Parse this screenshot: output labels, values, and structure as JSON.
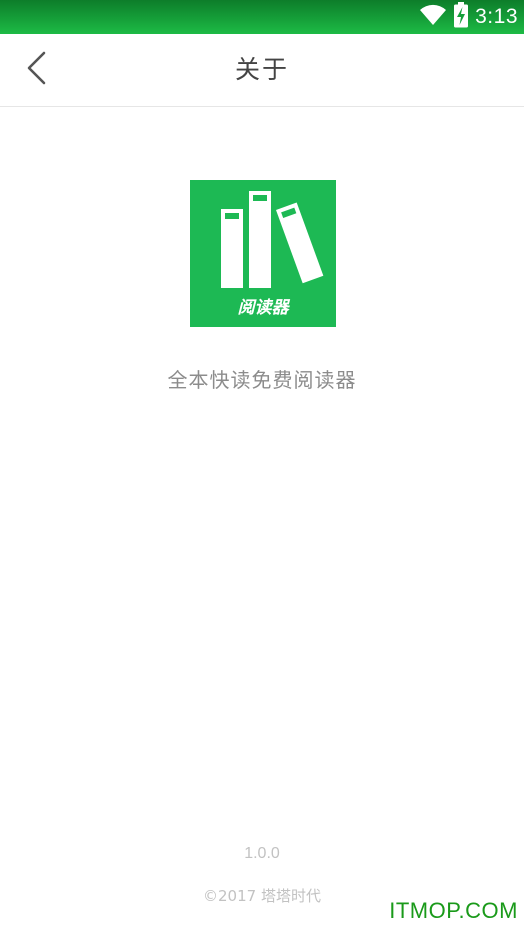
{
  "status_bar": {
    "time": "3:13",
    "icons": [
      "wifi-icon",
      "battery-charging-icon"
    ],
    "background": "#14a03a"
  },
  "header": {
    "back_icon": "chevron-left-icon",
    "title": "关于"
  },
  "about": {
    "logo_text": "阅读器",
    "logo_color": "#1db954",
    "app_name": "全本快读免费阅读器",
    "version": "1.0.0",
    "copyright": "©2017  塔塔时代"
  },
  "watermark": {
    "text": "ITMOP.COM",
    "color": "#1a9a1a"
  }
}
